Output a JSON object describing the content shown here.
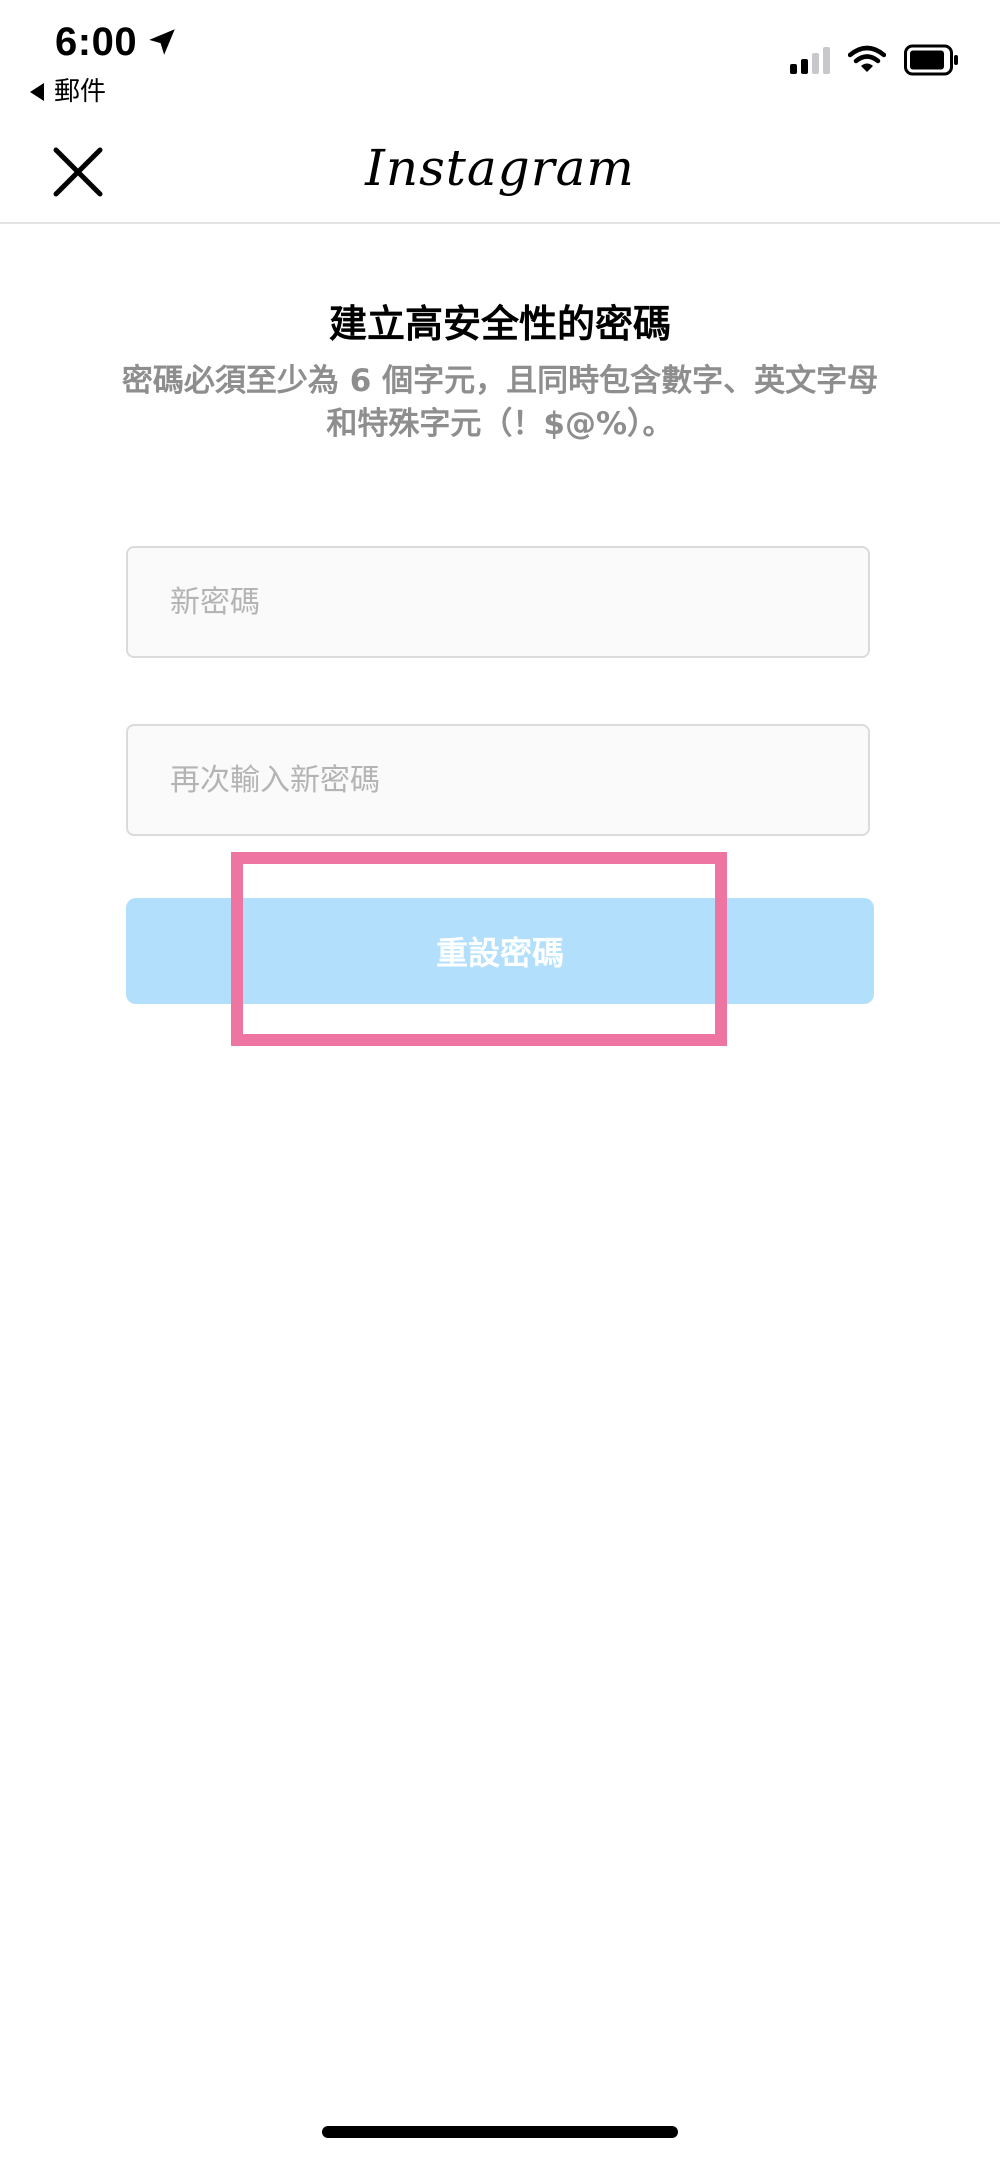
{
  "status_bar": {
    "time": "6:00",
    "back_app_label": "郵件",
    "icons": [
      "location-arrow-icon",
      "cellular-signal-icon",
      "wifi-icon",
      "battery-icon"
    ]
  },
  "nav": {
    "close_icon": "close-icon",
    "logo_text": "Instagram"
  },
  "content": {
    "title": "建立高安全性的密碼",
    "subtitle": "密碼必須至少為 6 個字元，且同時包含數字、英文字母和特殊字元（！$@%）。",
    "new_password_placeholder": "新密碼",
    "confirm_password_placeholder": "再次輸入新密碼",
    "reset_button_label": "重設密碼"
  },
  "colors": {
    "button_disabled_bg": "#b2dffc",
    "highlight_border": "#ee74a2",
    "subtitle_text": "#8e8e8e",
    "field_border": "#dbdbdb",
    "field_bg": "#fafafa"
  }
}
